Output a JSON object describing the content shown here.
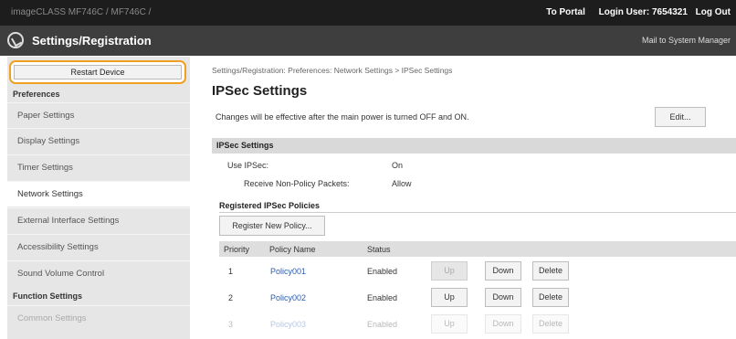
{
  "topbar": {
    "device_info": "imageCLASS    MF746C / MF746C /",
    "to_portal": "To Portal",
    "login_user": "Login User:  7654321",
    "logout": "Log Out"
  },
  "header": {
    "title": "Settings/Registration",
    "mail": "Mail to System Manager"
  },
  "sidebar": {
    "restart_label": "Restart Device",
    "preferences_label": "Preferences",
    "items": [
      "Paper Settings",
      "Display Settings",
      "Timer Settings",
      "Network Settings",
      "External Interface Settings",
      "Accessibility Settings",
      "Sound Volume Control"
    ],
    "function_settings_label": "Function Settings",
    "function_items": [
      "Common Settings"
    ]
  },
  "main": {
    "breadcrumb": "Settings/Registration: Preferences: Network Settings > IPSec Settings",
    "title": "IPSec Settings",
    "notice": "Changes will be effective after the main power is turned OFF and ON.",
    "edit_label": "Edit...",
    "section_title": "IPSec Settings",
    "use_ipsec_label": "Use IPSec:",
    "use_ipsec_value": "On",
    "non_policy_label": "Receive Non-Policy Packets:",
    "non_policy_value": "Allow",
    "registered_title": "Registered IPSec Policies",
    "register_button": "Register New Policy...",
    "columns": [
      "Priority",
      "Policy Name",
      "Status"
    ],
    "rows": [
      {
        "priority": "1",
        "name": "Policy001",
        "status": "Enabled"
      },
      {
        "priority": "2",
        "name": "Policy002",
        "status": "Enabled"
      },
      {
        "priority": "3",
        "name": "Policy003",
        "status": "Enabled"
      }
    ],
    "up_label": "Up",
    "down_label": "Down",
    "delete_label": "Delete"
  },
  "colors": {
    "highlight": "#f0a020",
    "link": "#2a5db0",
    "titlebar": "#3e3e3e"
  }
}
